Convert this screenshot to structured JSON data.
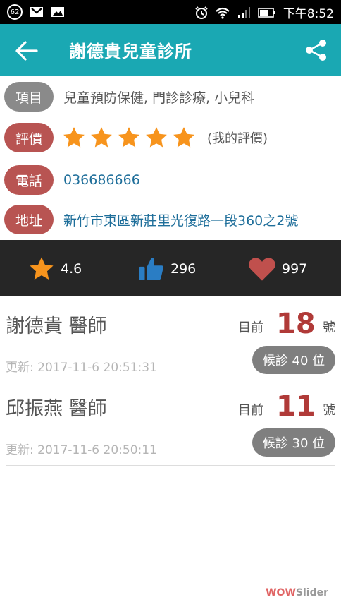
{
  "status_bar": {
    "badge": "62",
    "time": "下午8:52",
    "icons": [
      "mail-icon",
      "image-icon",
      "alarm-icon",
      "wifi-icon",
      "signal-icon",
      "battery-icon"
    ]
  },
  "app_bar": {
    "title": "謝德貴兒童診所",
    "icons": [
      "back-arrow-icon",
      "share-icon"
    ],
    "color": "#1aa8b3"
  },
  "info": {
    "item": {
      "label": "項目",
      "value": "兒童預防保健, 門診診療, 小兒科"
    },
    "rating": {
      "label": "評價",
      "stars": 5,
      "my_rating": "(我的評價)"
    },
    "phone": {
      "label": "電話",
      "value": "036686666"
    },
    "address": {
      "label": "地址",
      "value": "新竹市東區新莊里光復路一段360之2號"
    }
  },
  "stats": {
    "rating": "4.6",
    "likes": "296",
    "favorites": "997"
  },
  "doctors": [
    {
      "name": "謝德貴 醫師",
      "current_label": "目前",
      "number": "18",
      "unit": "號",
      "waiting": "候診 40 位",
      "updated": "更新: 2017-11-6 20:51:31"
    },
    {
      "name": "邱振燕 醫師",
      "current_label": "目前",
      "number": "11",
      "unit": "號",
      "waiting": "候診 30 位",
      "updated": "更新: 2017-11-6 20:50:11"
    }
  ],
  "watermark": {
    "part1": "WOW",
    "part2": "Slider"
  },
  "colors": {
    "accent": "#1aa8b3",
    "star": "#f7941d",
    "label_red": "#b85452",
    "number_red": "#b03a38",
    "link_blue": "#1e6e9a"
  }
}
